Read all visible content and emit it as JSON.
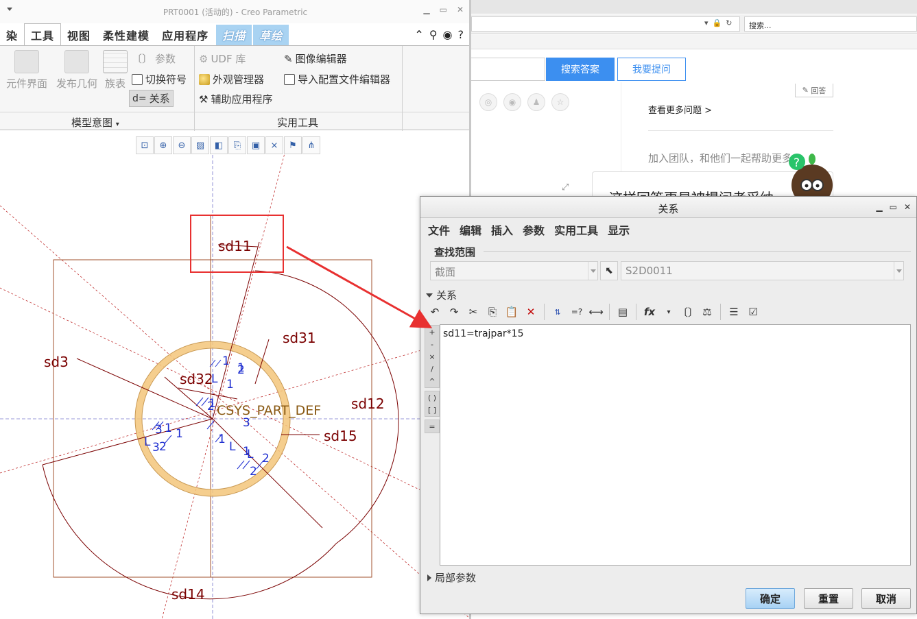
{
  "creo": {
    "title": "PRT0001 (活动的) - Creo Parametric",
    "tabs": [
      "染",
      "工具",
      "视图",
      "柔性建模",
      "应用程序"
    ],
    "special_tabs": [
      "扫描",
      "草绘"
    ],
    "ribbon": {
      "big_buttons": [
        "元件界面",
        "发布几何",
        "族表"
      ],
      "params": "参数",
      "switch_symbol": "切换符号",
      "relations": "关系",
      "udf": "UDF 库",
      "appearance": "外观管理器",
      "aux_app": "辅助应用程序",
      "image_editor": "图像编辑器",
      "import_config": "导入配置文件编辑器",
      "group_model_intent": "模型意图",
      "group_utilities": "实用工具"
    },
    "sketch": {
      "dims": [
        "sd11",
        "sd31",
        "sd3",
        "sd32",
        "sd12",
        "sd15",
        "sd14"
      ],
      "csys_label": "CSYS_PART_DEF",
      "constraints": [
        "1",
        "1",
        "1",
        "2",
        "L",
        "1",
        "2",
        "3",
        "3",
        "1",
        "1",
        "L",
        "3",
        "2",
        "1",
        "L",
        "1",
        "2",
        "2",
        "L"
      ]
    }
  },
  "browser": {
    "search_placeholder": "搜索...",
    "search_answer": "搜索答案",
    "ask_question": "我要提问",
    "answer_button": "回答",
    "more_questions": "查看更多问题 >",
    "join_team": "加入团队，和他们一起帮助更多",
    "card_title": "这样回答更易被提问者采纳",
    "share_icons": [
      "wechat-icon",
      "weibo-icon",
      "qq-icon",
      "star-icon"
    ]
  },
  "dialog": {
    "title": "关系",
    "menus": [
      "文件",
      "编辑",
      "插入",
      "参数",
      "实用工具",
      "显示"
    ],
    "lookup_label": "查找范围",
    "scope_value": "截面",
    "section_value": "S2D0011",
    "relations_section": "关系",
    "relation_text": "sd11=trajpar*15",
    "local_params": "局部参数",
    "ok": "确定",
    "reset": "重置",
    "cancel": "取消",
    "ops": [
      "+",
      "-",
      "×",
      "/",
      "^",
      "( )",
      "[ ]",
      "="
    ]
  },
  "colors": {
    "dim_color": "#7a0000",
    "constraint_color": "#1f2fd0",
    "annotation_red": "#e83030",
    "sketch_ring": "#f3c67a",
    "accent_blue": "#3c8ff0"
  }
}
